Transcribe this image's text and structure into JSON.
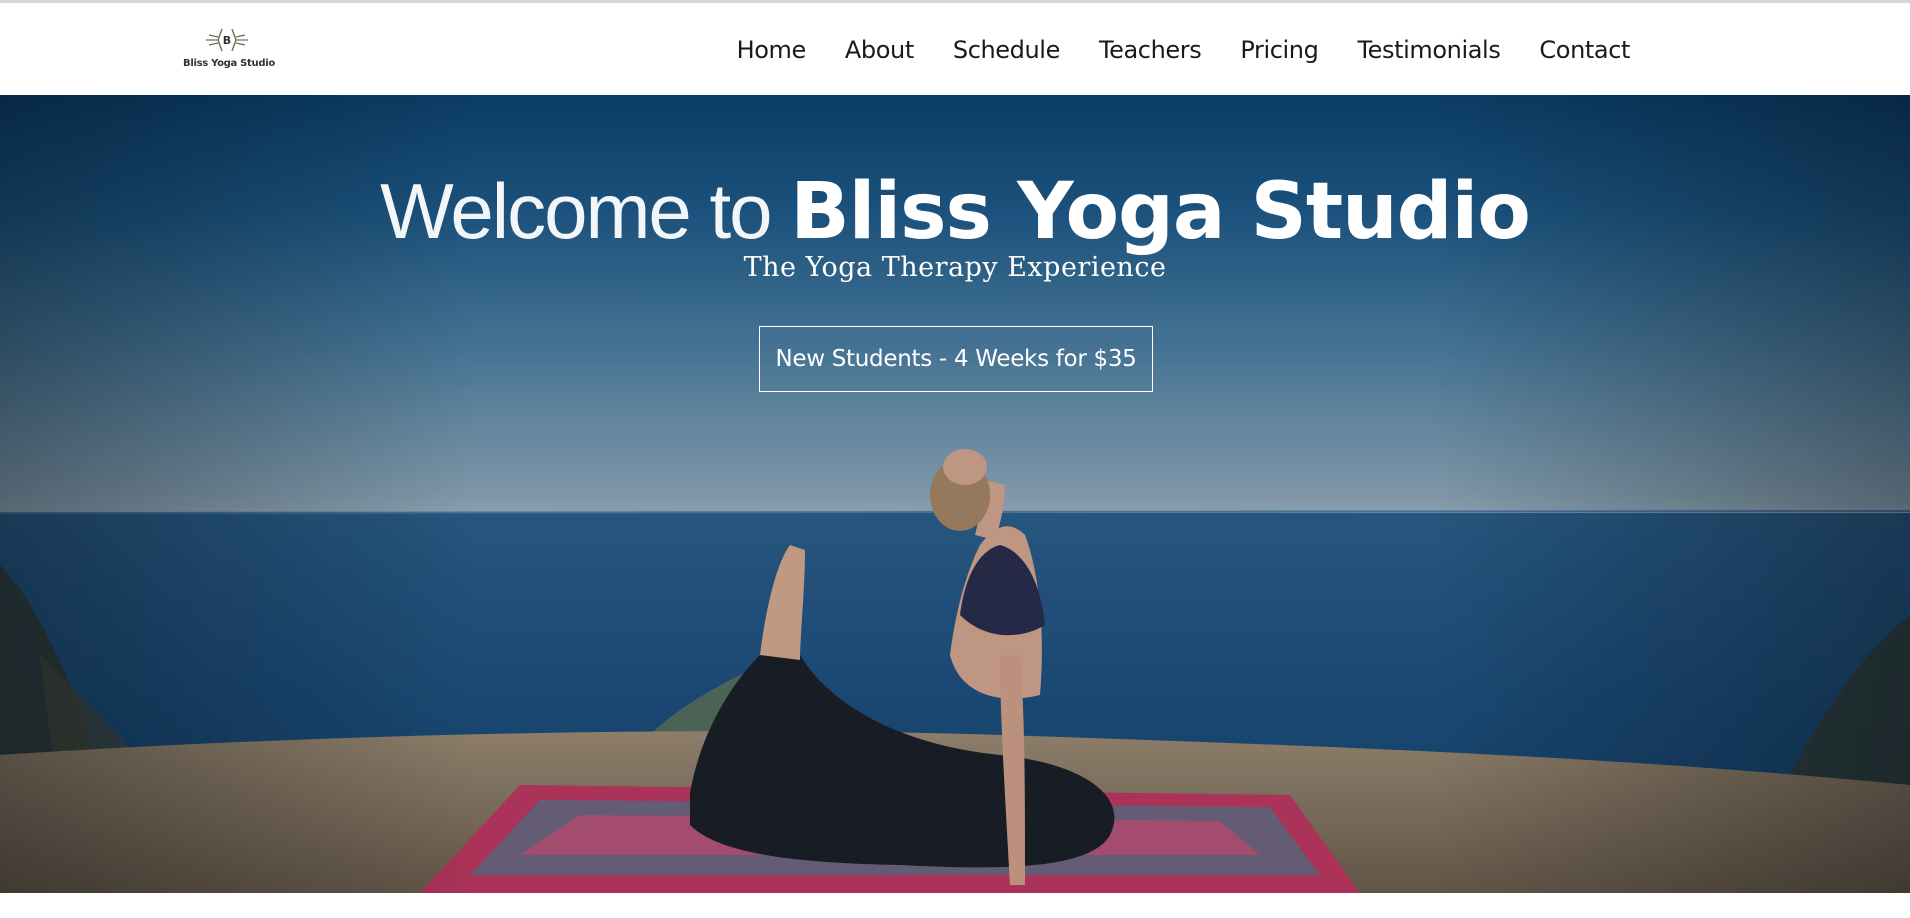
{
  "brand": {
    "logo_letter": "B",
    "logo_text": "Bliss Yoga Studio"
  },
  "nav": {
    "items": [
      {
        "label": "Home"
      },
      {
        "label": "About"
      },
      {
        "label": "Schedule"
      },
      {
        "label": "Teachers"
      },
      {
        "label": "Pricing"
      },
      {
        "label": "Testimonials"
      },
      {
        "label": "Contact"
      }
    ]
  },
  "hero": {
    "title_prefix": "Welcome to ",
    "title_brand": "Bliss Yoga Studio",
    "subtitle": "The Yoga Therapy Experience",
    "cta_label": "New Students - 4 Weeks for $35",
    "image_subject": "woman-yoga-pose-ocean-cliff"
  },
  "colors": {
    "header_bg": "#ffffff",
    "nav_text": "#1a1a1a",
    "hero_text": "#ffffff",
    "sky_top": "#0c3f69",
    "ocean": "#1e4f7a"
  }
}
